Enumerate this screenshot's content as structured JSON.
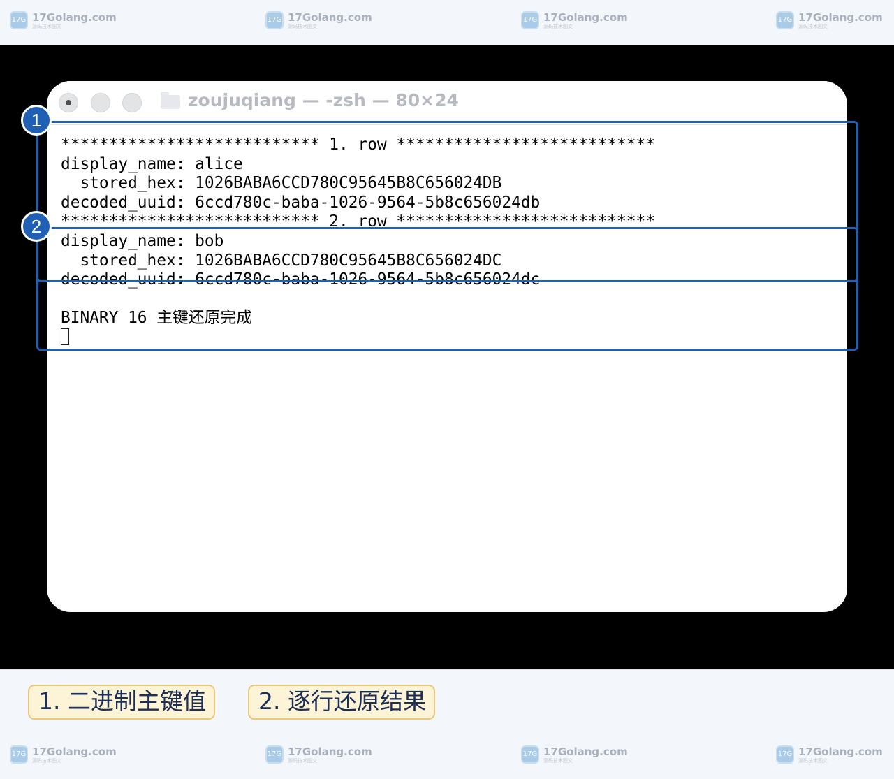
{
  "watermark": {
    "site": "17Golang.com",
    "tagline": "源码技术图文",
    "logo_text": "17G"
  },
  "window": {
    "title": "zoujuqiang — -zsh — 80×24"
  },
  "terminal": {
    "lines": [
      "*************************** 1. row ***************************",
      "display_name: alice",
      "  stored_hex: 1026BABA6CCD780C95645B8C656024DB",
      "decoded_uuid: 6ccd780c-baba-1026-9564-5b8c656024db",
      "*************************** 2. row ***************************",
      "display_name: bob",
      "  stored_hex: 1026BABA6CCD780C95645B8C656024DC",
      "decoded_uuid: 6ccd780c-baba-1026-9564-5b8c656024dc",
      "",
      "BINARY 16 主键还原完成"
    ]
  },
  "annotations": {
    "badge_1": "1",
    "badge_2": "2",
    "legend_1": "1. 二进制主键值",
    "legend_2": "2. 逐行还原结果"
  },
  "colors": {
    "accent": "#1f5fb4",
    "legend_bg": "#fdf3d6",
    "legend_border": "#e9c877",
    "stage": "#000000"
  }
}
